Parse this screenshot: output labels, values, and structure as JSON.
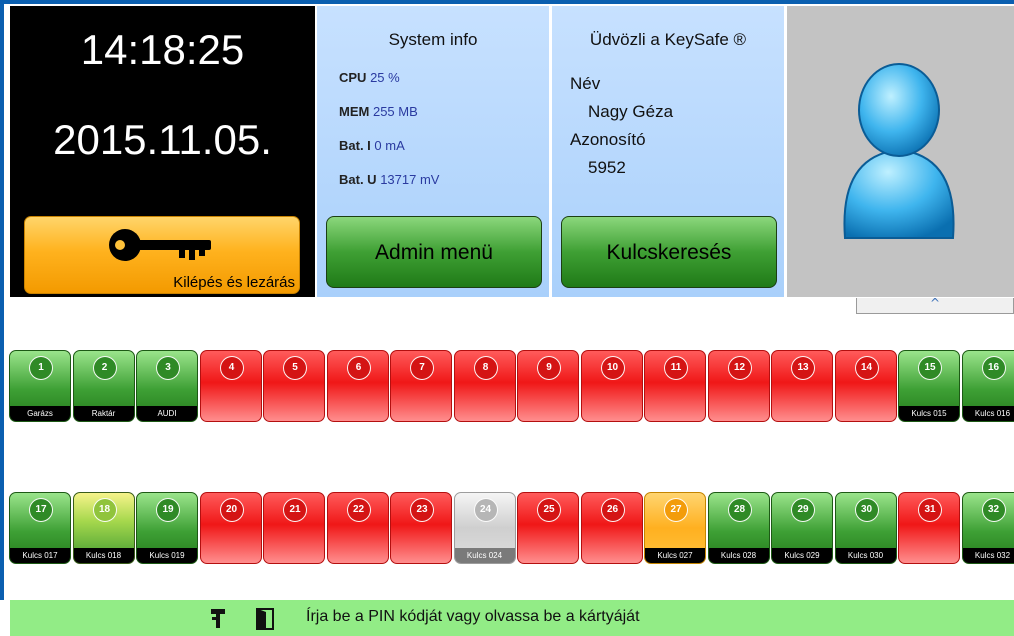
{
  "clock": {
    "time": "14:18:25",
    "date": "2015.11.05."
  },
  "exit_button": {
    "label": "Kilépés és lezárás"
  },
  "system_info": {
    "title": "System info",
    "cpu_label": "CPU",
    "cpu_value": "25 %",
    "mem_label": "MEM",
    "mem_value": "255 MB",
    "bati_label": "Bat. I",
    "bati_value": "0 mA",
    "batu_label": "Bat. U",
    "batu_value": "13717 mV",
    "admin_button": "Admin menü"
  },
  "welcome": {
    "title": "Üdvözli a KeySafe ®",
    "name_label": "Név",
    "name_value": "Nagy Géza",
    "id_label": "Azonosító",
    "id_value": "5952",
    "search_button": "Kulcskeresés"
  },
  "scroll_tab": {
    "glyph": "^"
  },
  "colors": {
    "available": "#3ea035",
    "taken": "#f01717",
    "selected": "#a6d84d",
    "disabled": "#cfcfcf",
    "warning": "#ffb020"
  },
  "keys_row1": [
    {
      "number": "1",
      "label": "Garázs",
      "status": "green"
    },
    {
      "number": "2",
      "label": "Raktár",
      "status": "green"
    },
    {
      "number": "3",
      "label": "AUDI",
      "status": "green"
    },
    {
      "number": "4",
      "label": "",
      "status": "red"
    },
    {
      "number": "5",
      "label": "",
      "status": "red"
    },
    {
      "number": "6",
      "label": "",
      "status": "red"
    },
    {
      "number": "7",
      "label": "",
      "status": "red"
    },
    {
      "number": "8",
      "label": "",
      "status": "red"
    },
    {
      "number": "9",
      "label": "",
      "status": "red"
    },
    {
      "number": "10",
      "label": "",
      "status": "red"
    },
    {
      "number": "11",
      "label": "",
      "status": "red"
    },
    {
      "number": "12",
      "label": "",
      "status": "red"
    },
    {
      "number": "13",
      "label": "",
      "status": "red"
    },
    {
      "number": "14",
      "label": "",
      "status": "red"
    },
    {
      "number": "15",
      "label": "Kulcs 015",
      "status": "green"
    },
    {
      "number": "16",
      "label": "Kulcs 016",
      "status": "green"
    }
  ],
  "keys_row2": [
    {
      "number": "17",
      "label": "Kulcs 017",
      "status": "green"
    },
    {
      "number": "18",
      "label": "Kulcs 018",
      "status": "yellow"
    },
    {
      "number": "19",
      "label": "Kulcs 019",
      "status": "green"
    },
    {
      "number": "20",
      "label": "",
      "status": "red"
    },
    {
      "number": "21",
      "label": "",
      "status": "red"
    },
    {
      "number": "22",
      "label": "",
      "status": "red"
    },
    {
      "number": "23",
      "label": "",
      "status": "red"
    },
    {
      "number": "24",
      "label": "Kulcs 024",
      "status": "gray"
    },
    {
      "number": "25",
      "label": "",
      "status": "red"
    },
    {
      "number": "26",
      "label": "",
      "status": "red"
    },
    {
      "number": "27",
      "label": "Kulcs 027",
      "status": "orange"
    },
    {
      "number": "28",
      "label": "Kulcs 028",
      "status": "green"
    },
    {
      "number": "29",
      "label": "Kulcs 029",
      "status": "green"
    },
    {
      "number": "30",
      "label": "Kulcs 030",
      "status": "green"
    },
    {
      "number": "31",
      "label": "",
      "status": "red"
    },
    {
      "number": "32",
      "label": "Kulcs 032",
      "status": "green"
    }
  ],
  "status_bar": {
    "message": "Írja be a PIN kódját vagy olvassa be a kártyáját",
    "icons": [
      "key-tag-icon",
      "door-icon"
    ]
  }
}
